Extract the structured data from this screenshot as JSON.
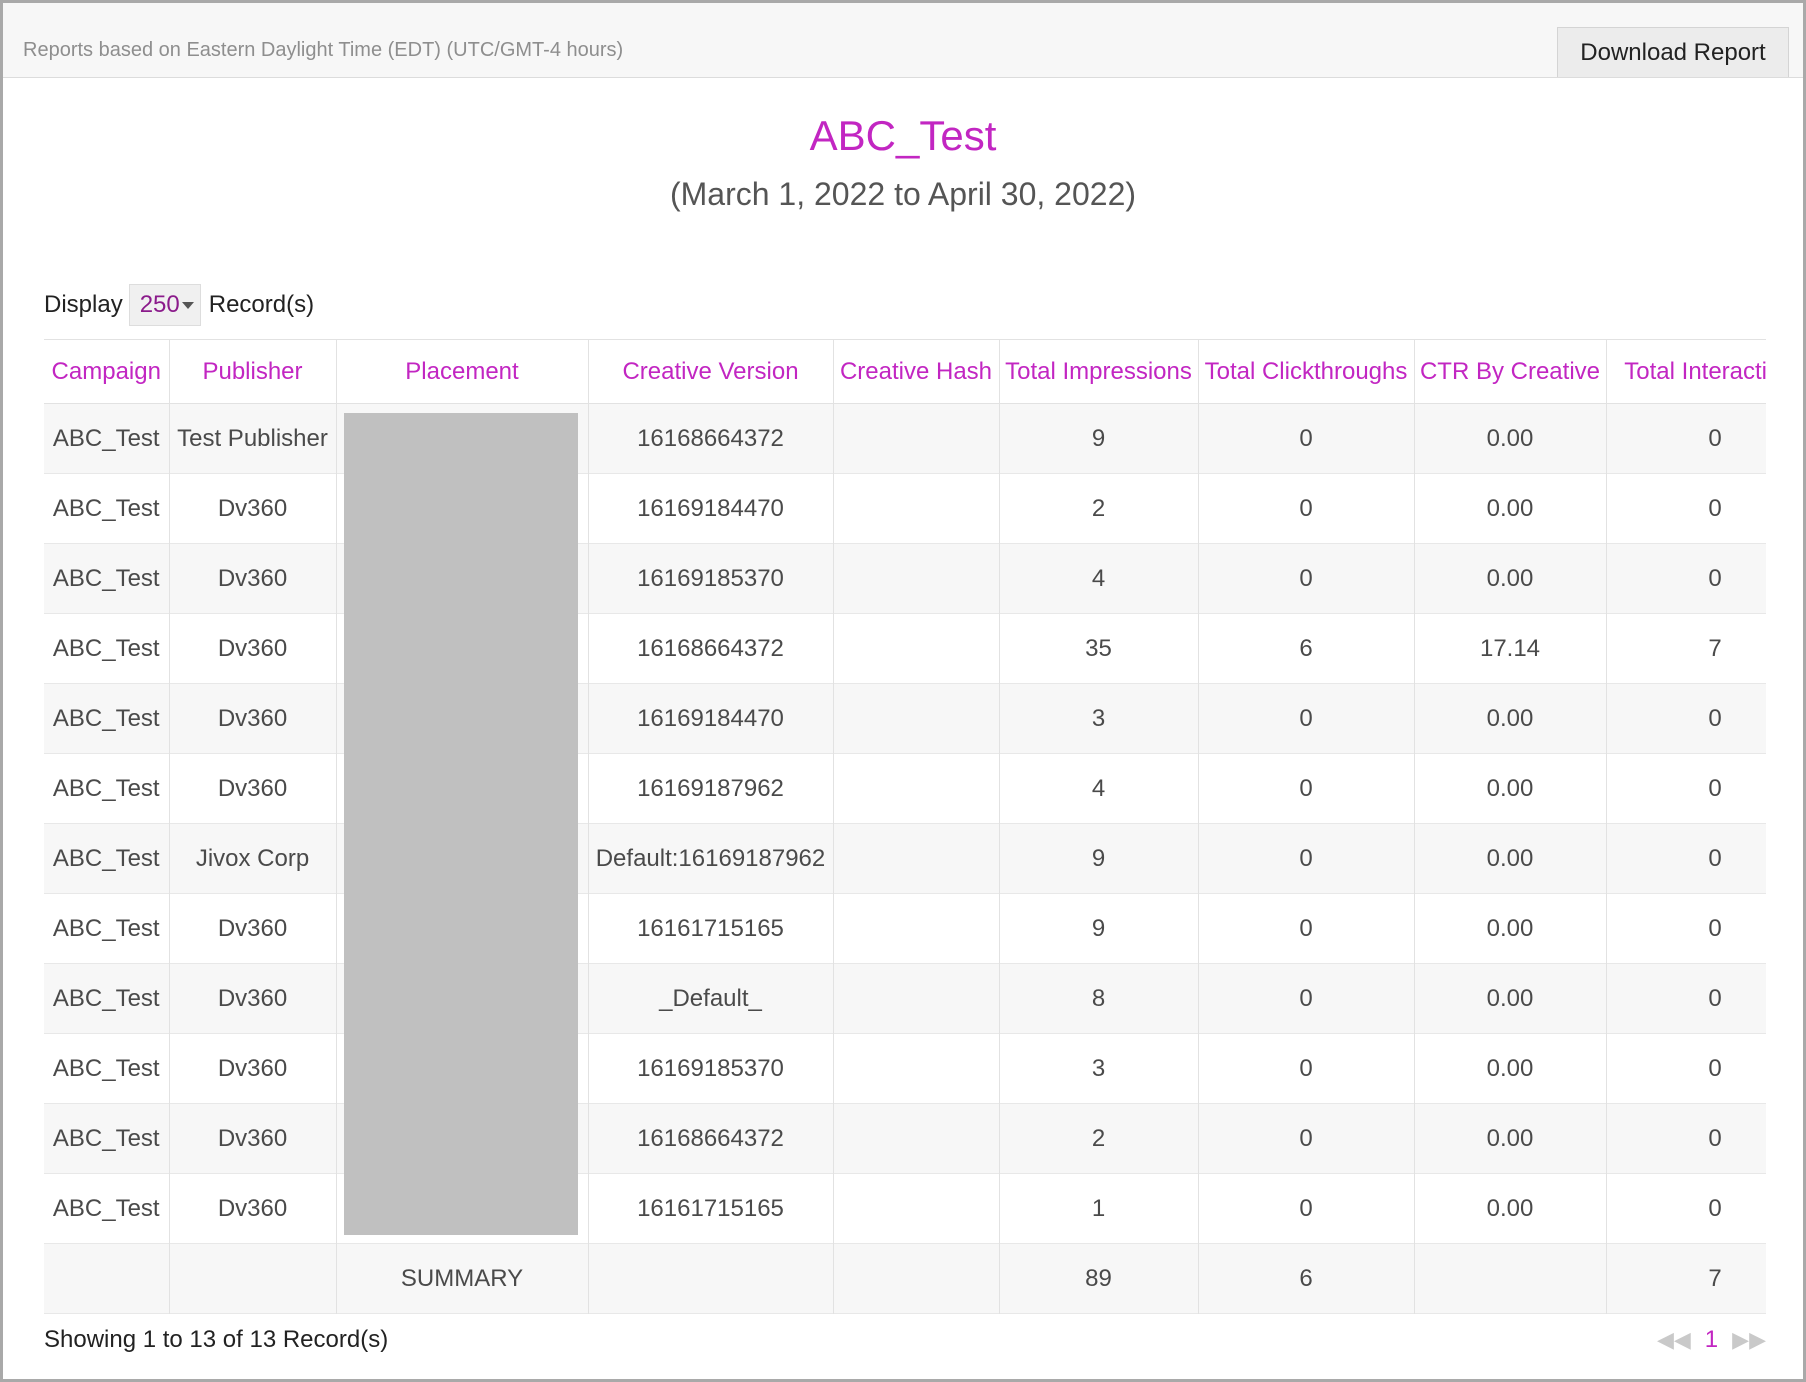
{
  "header": {
    "timezone_note": "Reports based on Eastern Daylight Time (EDT) (UTC/GMT-4 hours)",
    "download_label": "Download Report"
  },
  "report": {
    "title": "ABC_Test",
    "date_range": "(March 1, 2022 to April 30, 2022)"
  },
  "display": {
    "prefix": "Display",
    "value": "250",
    "suffix": "Record(s)"
  },
  "table": {
    "columns": [
      "Campaign",
      "Publisher",
      "Placement",
      "Creative Version",
      "Creative Hash",
      "Total Impressions",
      "Total Clickthroughs",
      "CTR By Creative",
      "Total Interactions"
    ],
    "rows": [
      [
        "ABC_Test",
        "Test Publisher",
        "",
        "16168664372",
        "",
        "9",
        "0",
        "0.00",
        "0"
      ],
      [
        "ABC_Test",
        "Dv360",
        "",
        "16169184470",
        "",
        "2",
        "0",
        "0.00",
        "0"
      ],
      [
        "ABC_Test",
        "Dv360",
        "",
        "16169185370",
        "",
        "4",
        "0",
        "0.00",
        "0"
      ],
      [
        "ABC_Test",
        "Dv360",
        "",
        "16168664372",
        "",
        "35",
        "6",
        "17.14",
        "7"
      ],
      [
        "ABC_Test",
        "Dv360",
        "",
        "16169184470",
        "",
        "3",
        "0",
        "0.00",
        "0"
      ],
      [
        "ABC_Test",
        "Dv360",
        "",
        "16169187962",
        "",
        "4",
        "0",
        "0.00",
        "0"
      ],
      [
        "ABC_Test",
        "Jivox Corp",
        "",
        "Default:16169187962",
        "",
        "9",
        "0",
        "0.00",
        "0"
      ],
      [
        "ABC_Test",
        "Dv360",
        "",
        "16161715165",
        "",
        "9",
        "0",
        "0.00",
        "0"
      ],
      [
        "ABC_Test",
        "Dv360",
        "",
        "_Default_",
        "",
        "8",
        "0",
        "0.00",
        "0"
      ],
      [
        "ABC_Test",
        "Dv360",
        "",
        "16169185370",
        "",
        "3",
        "0",
        "0.00",
        "0"
      ],
      [
        "ABC_Test",
        "Dv360",
        "",
        "16168664372",
        "",
        "2",
        "0",
        "0.00",
        "0"
      ],
      [
        "ABC_Test",
        "Dv360",
        "",
        "16161715165",
        "",
        "1",
        "0",
        "0.00",
        "0"
      ]
    ],
    "summary": [
      "",
      "",
      "SUMMARY",
      "",
      "",
      "89",
      "6",
      "",
      "7"
    ]
  },
  "footer": {
    "showing": "Showing 1 to 13 of 13 Record(s)",
    "page": "1",
    "first_icon": "first-page-icon",
    "last_icon": "last-page-icon"
  }
}
